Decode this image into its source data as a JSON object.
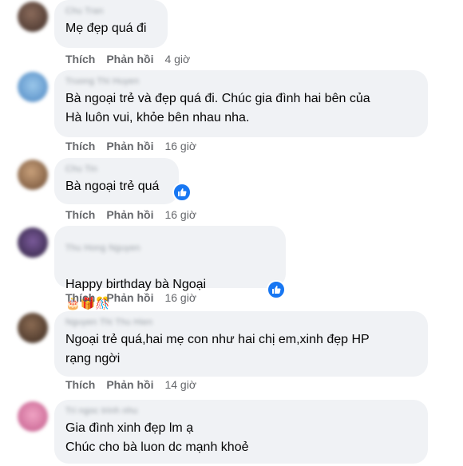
{
  "actions": {
    "like_label": "Thích",
    "reply_label": "Phản hồi"
  },
  "comments": [
    {
      "author": "Chu Tran",
      "text": "Mẹ đẹp quá đi",
      "time": "4 giờ"
    },
    {
      "author": "Truong Thi Huyen",
      "text": "Bà ngoại trẻ và đẹp quá đi. Chúc gia đình hai bên của\nHà luôn vui, khỏe bên nhau nha.",
      "time": "16 giờ"
    },
    {
      "author": "Chu Tin",
      "text": "Bà ngoại trẻ quá",
      "time": "16 giờ"
    },
    {
      "author": "Thu Hong Nguyen",
      "text": "Happy birthday bà Ngoại",
      "time": "16 giờ"
    },
    {
      "author": "Nguyen Thi Thu Hien",
      "text": "Ngoại trẻ quá,hai mẹ con như hai chị em,xinh đẹp HP\nrạng ngời",
      "time": "14 giờ"
    },
    {
      "author": "Tri ngoc trinh nhu",
      "text": "Gia đình xinh đẹp lm ạ\nChúc cho bà luon dc mạnh khoẻ",
      "time": ""
    }
  ],
  "emojis": [
    "🎂",
    "🎁",
    "🎊"
  ],
  "colors": {
    "bubble": "#f0f2f5",
    "meta": "#65676b",
    "like_blue": "#1877f2"
  },
  "icons": [
    "like-icon",
    "avatar"
  ]
}
